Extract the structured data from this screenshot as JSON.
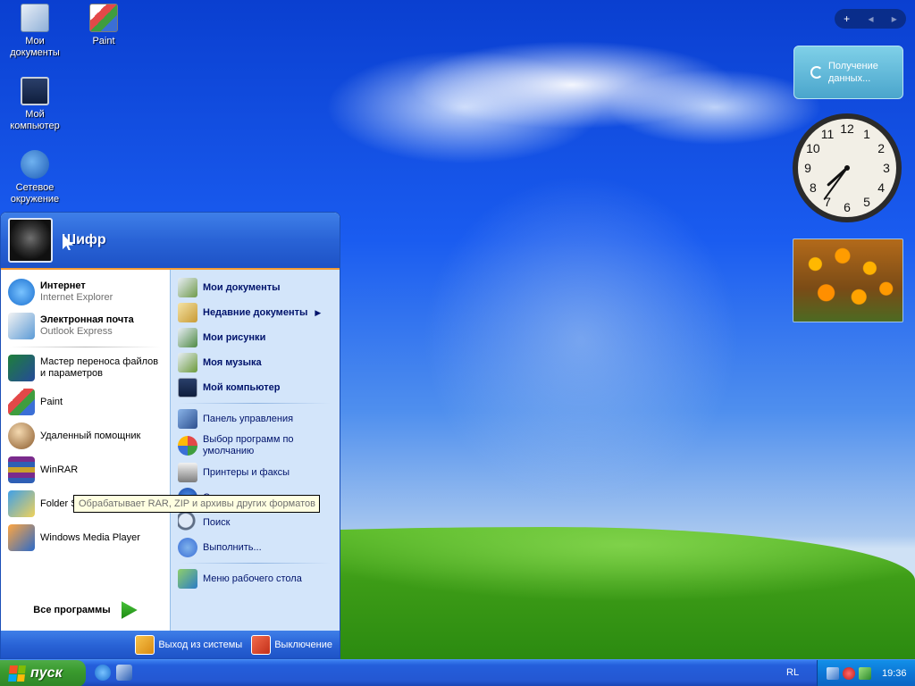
{
  "desktop": {
    "icons": [
      {
        "label": "Мои документы",
        "icon": "my-documents-icon"
      },
      {
        "label": "Paint",
        "icon": "paint-icon"
      },
      {
        "label": "Мой компьютер",
        "icon": "my-computer-icon"
      },
      {
        "label": "Сетевое окружение",
        "icon": "network-icon"
      }
    ]
  },
  "start_menu": {
    "user_name": "Шифр",
    "pinned": [
      {
        "title": "Интернет",
        "subtitle": "Internet Explorer",
        "icon": "ie-icon"
      },
      {
        "title": "Электронная почта",
        "subtitle": "Outlook Express",
        "icon": "outlook-icon"
      }
    ],
    "recent": [
      {
        "label": "Мастер переноса файлов и параметров",
        "icon": "transfer-wizard-icon"
      },
      {
        "label": "Paint",
        "icon": "paint-icon"
      },
      {
        "label": "Удаленный помощник",
        "icon": "remote-assistant-icon"
      },
      {
        "label": "WinRAR",
        "icon": "winrar-icon"
      },
      {
        "label": "Folder Settings",
        "icon": "folder-settings-icon"
      },
      {
        "label": "Windows Media Player",
        "icon": "media-player-icon"
      }
    ],
    "all_programs": "Все программы",
    "right_top": [
      {
        "label": "Мои документы",
        "icon": "my-documents-icon"
      },
      {
        "label": "Недавние документы",
        "icon": "recent-docs-icon",
        "has_submenu": true
      },
      {
        "label": "Мои рисунки",
        "icon": "my-pictures-icon"
      },
      {
        "label": "Моя музыка",
        "icon": "my-music-icon"
      },
      {
        "label": "Мой компьютер",
        "icon": "my-computer-icon"
      }
    ],
    "right_bottom": [
      {
        "label": "Панель управления",
        "icon": "control-panel-icon"
      },
      {
        "label": "Выбор программ по умолчанию",
        "icon": "default-programs-icon"
      },
      {
        "label": "Принтеры и факсы",
        "icon": "printer-icon"
      },
      {
        "label": "Справка и поддержка",
        "icon": "help-icon"
      },
      {
        "label": "Поиск",
        "icon": "search-icon"
      },
      {
        "label": "Выполнить...",
        "icon": "run-icon"
      }
    ],
    "desktop_menu": {
      "label": "Меню рабочего стола",
      "icon": "desktop-menu-icon"
    },
    "logoff": "Выход из системы",
    "shutdown": "Выключение"
  },
  "tooltip": "Обрабатывает RAR, ZIP и архивы других форматов",
  "taskbar": {
    "start_label": "пуск",
    "language": "RL",
    "time": "19:36"
  },
  "gadgets": {
    "toolbar_add": "+",
    "toolbar_prev": "◂",
    "toolbar_next": "▸",
    "news_text": "Получение данных...",
    "clock": {
      "hour": 7,
      "minute": 36
    }
  },
  "colors": {
    "accent": "#f39b34",
    "menu_blue": "#2963d6",
    "start_green": "#3a9b2e"
  }
}
